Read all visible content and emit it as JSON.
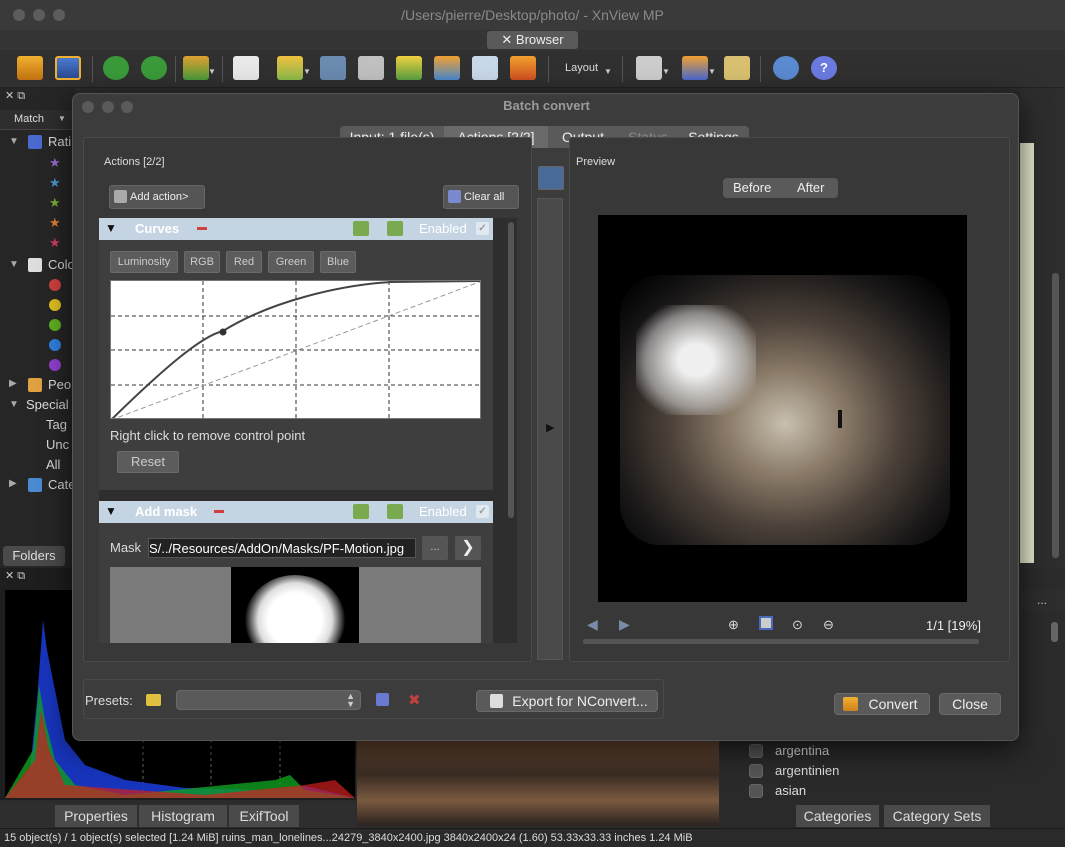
{
  "window": {
    "title": "/Users/pierre/Desktop/photo/ - XnView MP"
  },
  "browser_tab": {
    "label": "✕ Browser"
  },
  "toolbar": {
    "layout_label": "Layout"
  },
  "left_tree": {
    "match_label": "Match",
    "items": [
      {
        "label": "Rati",
        "icon": "rating-icon"
      },
      {
        "label": "Colo",
        "icon": "color-label-icon"
      },
      {
        "label": "Peo",
        "icon": "people-icon"
      },
      {
        "label": "Special",
        "icon": ""
      },
      {
        "label": "Tag"
      },
      {
        "label": "Unc"
      },
      {
        "label": "All"
      },
      {
        "label": "Cate",
        "icon": "category-icon"
      }
    ],
    "folders_tab": "Folders"
  },
  "bottom_tabs": [
    "Properties",
    "Histogram",
    "ExifTool"
  ],
  "categories": {
    "items": [
      "argentina",
      "argentinien",
      "asian"
    ],
    "tabs": [
      "Categories",
      "Category Sets"
    ]
  },
  "status": {
    "text": "15 object(s) / 1 object(s) selected [1.24 MiB]  ruins_man_lonelines...24279_3840x2400.jpg  3840x2400x24 (1.60)  53.33x33.33 inches  1.24 MiB"
  },
  "dialog": {
    "title": "Batch convert",
    "tabs": [
      "Input: 1 file(s)",
      "Actions [2/2]",
      "Output",
      "Status",
      "Settings"
    ],
    "actions_label": "Actions [2/2]",
    "add_action": "Add action>",
    "clear_all": "Clear all",
    "curves": {
      "title": "Curves",
      "enabled": "Enabled",
      "channels": [
        "Luminosity",
        "RGB",
        "Red",
        "Green",
        "Blue"
      ],
      "hint": "Right click to remove control point",
      "reset": "Reset"
    },
    "mask": {
      "title": "Add mask",
      "enabled": "Enabled",
      "label": "Mask",
      "value": "S/../Resources/AddOn/Masks/PF-Motion.jpg",
      "browse": "..."
    },
    "preview": {
      "label": "Preview",
      "before": "Before",
      "after": "After",
      "page": "1/1 [19%]"
    },
    "presets_label": "Presets:",
    "export_button": "Export for NConvert...",
    "convert_button": "Convert",
    "close_button": "Close"
  }
}
